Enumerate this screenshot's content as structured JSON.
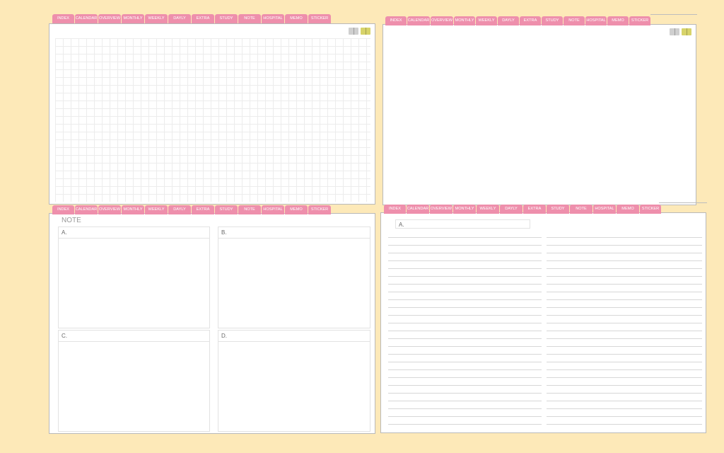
{
  "tabs": [
    "INDEX",
    "CALENDAR",
    "OVERVIEW",
    "MONTHLY",
    "WEEKLY",
    "DAYLY",
    "EXTRA",
    "STUDY",
    "NOTE",
    "HOSPITAL",
    "MEMO",
    "STICKER"
  ],
  "page_icons": {
    "gray_book_icon": "book-gray-icon",
    "yellow_book_icon": "book-yellow-icon",
    "gray_book_text": "□□",
    "yellow_book_text": "□□"
  },
  "note_page": {
    "title": "NOTE",
    "boxes": [
      "A.",
      "B.",
      "C.",
      "D."
    ]
  },
  "lined_page": {
    "field_label": "A."
  },
  "colors": {
    "background": "#fde9b8",
    "tab": "#ee8fac",
    "page": "#ffffff"
  }
}
